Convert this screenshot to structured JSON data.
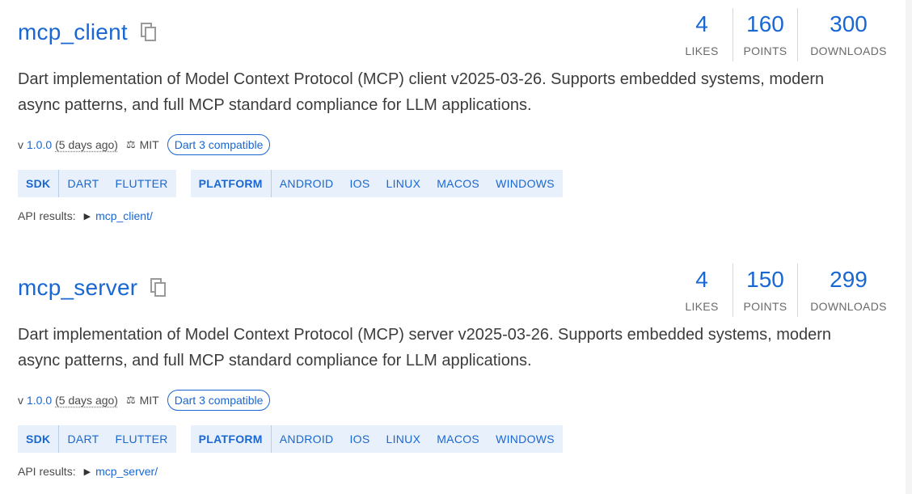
{
  "packages": [
    {
      "name": "mcp_client",
      "likes": "4",
      "points": "160",
      "downloads": "300",
      "likes_label": "LIKES",
      "points_label": "POINTS",
      "downloads_label": "DOWNLOADS",
      "description_line1": "Dart implementation of Model Context Protocol (MCP) client v2025-03-26. Supports embedded systems, modern",
      "description_line2": "async patterns, and full MCP standard compliance for LLM applications.",
      "version_prefix": "v",
      "version": "1.0.0",
      "published": "(5 days ago)",
      "license": "MIT",
      "badge": "Dart 3 compatible",
      "sdk_label": "SDK",
      "sdk_tags": [
        "DART",
        "FLUTTER"
      ],
      "platform_label": "PLATFORM",
      "platform_tags": [
        "ANDROID",
        "IOS",
        "LINUX",
        "MACOS",
        "WINDOWS"
      ],
      "api_label": "API results:",
      "api_link": "mcp_client/"
    },
    {
      "name": "mcp_server",
      "likes": "4",
      "points": "150",
      "downloads": "299",
      "likes_label": "LIKES",
      "points_label": "POINTS",
      "downloads_label": "DOWNLOADS",
      "description_line1": "Dart implementation of Model Context Protocol (MCP) server v2025-03-26. Supports embedded systems, modern",
      "description_line2": "async patterns, and full MCP standard compliance for LLM applications.",
      "version_prefix": "v",
      "version": "1.0.0",
      "published": "(5 days ago)",
      "license": "MIT",
      "badge": "Dart 3 compatible",
      "sdk_label": "SDK",
      "sdk_tags": [
        "DART",
        "FLUTTER"
      ],
      "platform_label": "PLATFORM",
      "platform_tags": [
        "ANDROID",
        "IOS",
        "LINUX",
        "MACOS",
        "WINDOWS"
      ],
      "api_label": "API results:",
      "api_link": "mcp_server/"
    }
  ],
  "icons": {
    "copy": "copy-icon",
    "license": "balance-scale-icon",
    "expand": "triangle-right-icon"
  },
  "colors": {
    "accent": "#1967d2",
    "tag_bg": "#e8f1fb",
    "text": "#3c3c3c"
  }
}
